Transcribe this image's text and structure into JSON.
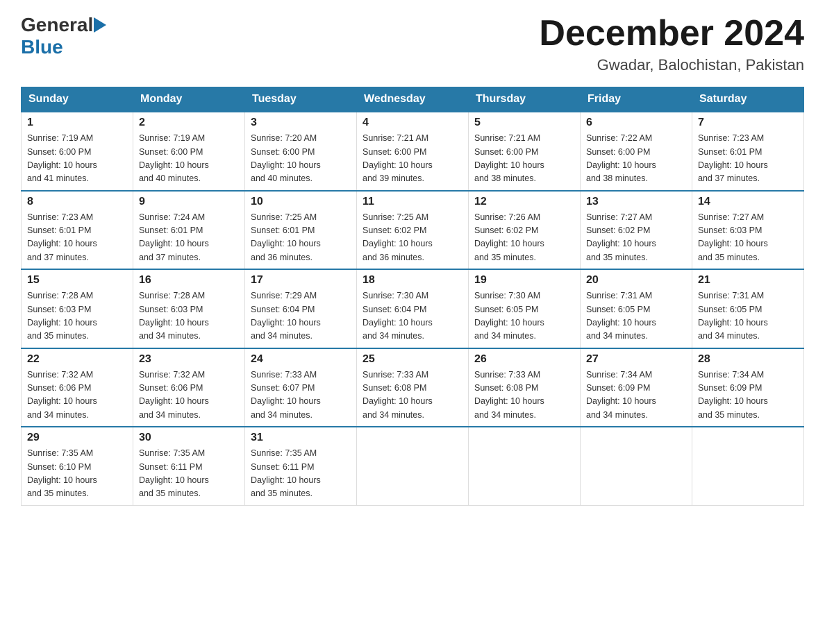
{
  "header": {
    "logo_general": "General",
    "logo_blue": "Blue",
    "month_title": "December 2024",
    "location": "Gwadar, Balochistan, Pakistan"
  },
  "days_of_week": [
    "Sunday",
    "Monday",
    "Tuesday",
    "Wednesday",
    "Thursday",
    "Friday",
    "Saturday"
  ],
  "weeks": [
    [
      {
        "day": "1",
        "sunrise": "7:19 AM",
        "sunset": "6:00 PM",
        "daylight": "10 hours and 41 minutes."
      },
      {
        "day": "2",
        "sunrise": "7:19 AM",
        "sunset": "6:00 PM",
        "daylight": "10 hours and 40 minutes."
      },
      {
        "day": "3",
        "sunrise": "7:20 AM",
        "sunset": "6:00 PM",
        "daylight": "10 hours and 40 minutes."
      },
      {
        "day": "4",
        "sunrise": "7:21 AM",
        "sunset": "6:00 PM",
        "daylight": "10 hours and 39 minutes."
      },
      {
        "day": "5",
        "sunrise": "7:21 AM",
        "sunset": "6:00 PM",
        "daylight": "10 hours and 38 minutes."
      },
      {
        "day": "6",
        "sunrise": "7:22 AM",
        "sunset": "6:00 PM",
        "daylight": "10 hours and 38 minutes."
      },
      {
        "day": "7",
        "sunrise": "7:23 AM",
        "sunset": "6:01 PM",
        "daylight": "10 hours and 37 minutes."
      }
    ],
    [
      {
        "day": "8",
        "sunrise": "7:23 AM",
        "sunset": "6:01 PM",
        "daylight": "10 hours and 37 minutes."
      },
      {
        "day": "9",
        "sunrise": "7:24 AM",
        "sunset": "6:01 PM",
        "daylight": "10 hours and 37 minutes."
      },
      {
        "day": "10",
        "sunrise": "7:25 AM",
        "sunset": "6:01 PM",
        "daylight": "10 hours and 36 minutes."
      },
      {
        "day": "11",
        "sunrise": "7:25 AM",
        "sunset": "6:02 PM",
        "daylight": "10 hours and 36 minutes."
      },
      {
        "day": "12",
        "sunrise": "7:26 AM",
        "sunset": "6:02 PM",
        "daylight": "10 hours and 35 minutes."
      },
      {
        "day": "13",
        "sunrise": "7:27 AM",
        "sunset": "6:02 PM",
        "daylight": "10 hours and 35 minutes."
      },
      {
        "day": "14",
        "sunrise": "7:27 AM",
        "sunset": "6:03 PM",
        "daylight": "10 hours and 35 minutes."
      }
    ],
    [
      {
        "day": "15",
        "sunrise": "7:28 AM",
        "sunset": "6:03 PM",
        "daylight": "10 hours and 35 minutes."
      },
      {
        "day": "16",
        "sunrise": "7:28 AM",
        "sunset": "6:03 PM",
        "daylight": "10 hours and 34 minutes."
      },
      {
        "day": "17",
        "sunrise": "7:29 AM",
        "sunset": "6:04 PM",
        "daylight": "10 hours and 34 minutes."
      },
      {
        "day": "18",
        "sunrise": "7:30 AM",
        "sunset": "6:04 PM",
        "daylight": "10 hours and 34 minutes."
      },
      {
        "day": "19",
        "sunrise": "7:30 AM",
        "sunset": "6:05 PM",
        "daylight": "10 hours and 34 minutes."
      },
      {
        "day": "20",
        "sunrise": "7:31 AM",
        "sunset": "6:05 PM",
        "daylight": "10 hours and 34 minutes."
      },
      {
        "day": "21",
        "sunrise": "7:31 AM",
        "sunset": "6:05 PM",
        "daylight": "10 hours and 34 minutes."
      }
    ],
    [
      {
        "day": "22",
        "sunrise": "7:32 AM",
        "sunset": "6:06 PM",
        "daylight": "10 hours and 34 minutes."
      },
      {
        "day": "23",
        "sunrise": "7:32 AM",
        "sunset": "6:06 PM",
        "daylight": "10 hours and 34 minutes."
      },
      {
        "day": "24",
        "sunrise": "7:33 AM",
        "sunset": "6:07 PM",
        "daylight": "10 hours and 34 minutes."
      },
      {
        "day": "25",
        "sunrise": "7:33 AM",
        "sunset": "6:08 PM",
        "daylight": "10 hours and 34 minutes."
      },
      {
        "day": "26",
        "sunrise": "7:33 AM",
        "sunset": "6:08 PM",
        "daylight": "10 hours and 34 minutes."
      },
      {
        "day": "27",
        "sunrise": "7:34 AM",
        "sunset": "6:09 PM",
        "daylight": "10 hours and 34 minutes."
      },
      {
        "day": "28",
        "sunrise": "7:34 AM",
        "sunset": "6:09 PM",
        "daylight": "10 hours and 35 minutes."
      }
    ],
    [
      {
        "day": "29",
        "sunrise": "7:35 AM",
        "sunset": "6:10 PM",
        "daylight": "10 hours and 35 minutes."
      },
      {
        "day": "30",
        "sunrise": "7:35 AM",
        "sunset": "6:11 PM",
        "daylight": "10 hours and 35 minutes."
      },
      {
        "day": "31",
        "sunrise": "7:35 AM",
        "sunset": "6:11 PM",
        "daylight": "10 hours and 35 minutes."
      },
      null,
      null,
      null,
      null
    ]
  ],
  "labels": {
    "sunrise_prefix": "Sunrise: ",
    "sunset_prefix": "Sunset: ",
    "daylight_prefix": "Daylight: "
  }
}
